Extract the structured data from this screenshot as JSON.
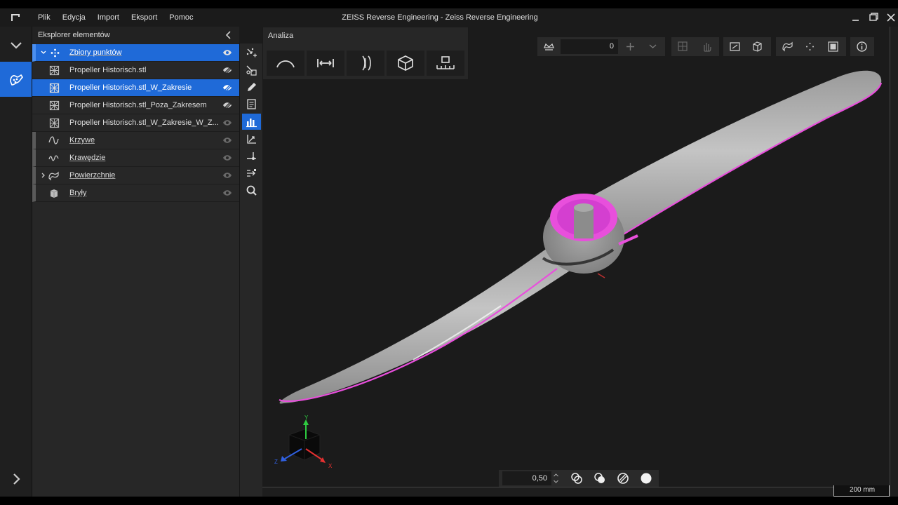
{
  "window": {
    "title": "ZEISS Reverse Engineering - Zeiss Reverse Engineering",
    "menu": [
      "Plik",
      "Edycja",
      "Import",
      "Eksport",
      "Pomoc"
    ]
  },
  "explorer": {
    "title": "Eksplorer elementów",
    "items": [
      {
        "label": "Zbiory punktów",
        "kind": "group",
        "icon": "point-cloud-icon",
        "visibility": "visible-icon",
        "selected": true
      },
      {
        "label": "Propeller Historisch.stl",
        "kind": "mesh",
        "icon": "mesh-icon",
        "visibility": "hidden-icon",
        "selected": false
      },
      {
        "label": "Propeller Historisch.stl_W_Zakresie",
        "kind": "mesh",
        "icon": "mesh-icon",
        "visibility": "hidden-icon",
        "selected": true
      },
      {
        "label": "Propeller Historisch.stl_Poza_Zakresem",
        "kind": "mesh",
        "icon": "mesh-icon",
        "visibility": "hidden-icon",
        "selected": false
      },
      {
        "label": "Propeller Historisch.stl_W_Zakresie_W_Z...",
        "kind": "mesh",
        "icon": "mesh-icon",
        "visibility": "visible-icon",
        "selected": false
      },
      {
        "label": "Krzywe",
        "kind": "group",
        "icon": "curve-icon",
        "visibility": "visible-icon",
        "selected": false
      },
      {
        "label": "Krawędzie",
        "kind": "group",
        "icon": "edge-icon",
        "visibility": "visible-icon",
        "selected": false
      },
      {
        "label": "Powierzchnie",
        "kind": "group",
        "icon": "surface-icon",
        "visibility": "visible-icon",
        "selected": false
      },
      {
        "label": "Bryły",
        "kind": "group",
        "icon": "solid-icon",
        "visibility": "visible-icon",
        "selected": false
      }
    ]
  },
  "analysis": {
    "title": "Analiza",
    "tools": [
      "curvature-icon",
      "distance-icon",
      "thickness-icon",
      "cube-icon",
      "ruler-icon"
    ]
  },
  "viewport_toolbar": {
    "counter": "0"
  },
  "bottom_toolbar": {
    "value": "0,50"
  },
  "scale": {
    "label": "200 mm"
  },
  "gizmo": {
    "x": "X",
    "y": "Y",
    "z": "Z"
  },
  "colors": {
    "accent": "#1f6ad8",
    "deviation": "#e84fdc",
    "model": "#b8b8b8"
  }
}
